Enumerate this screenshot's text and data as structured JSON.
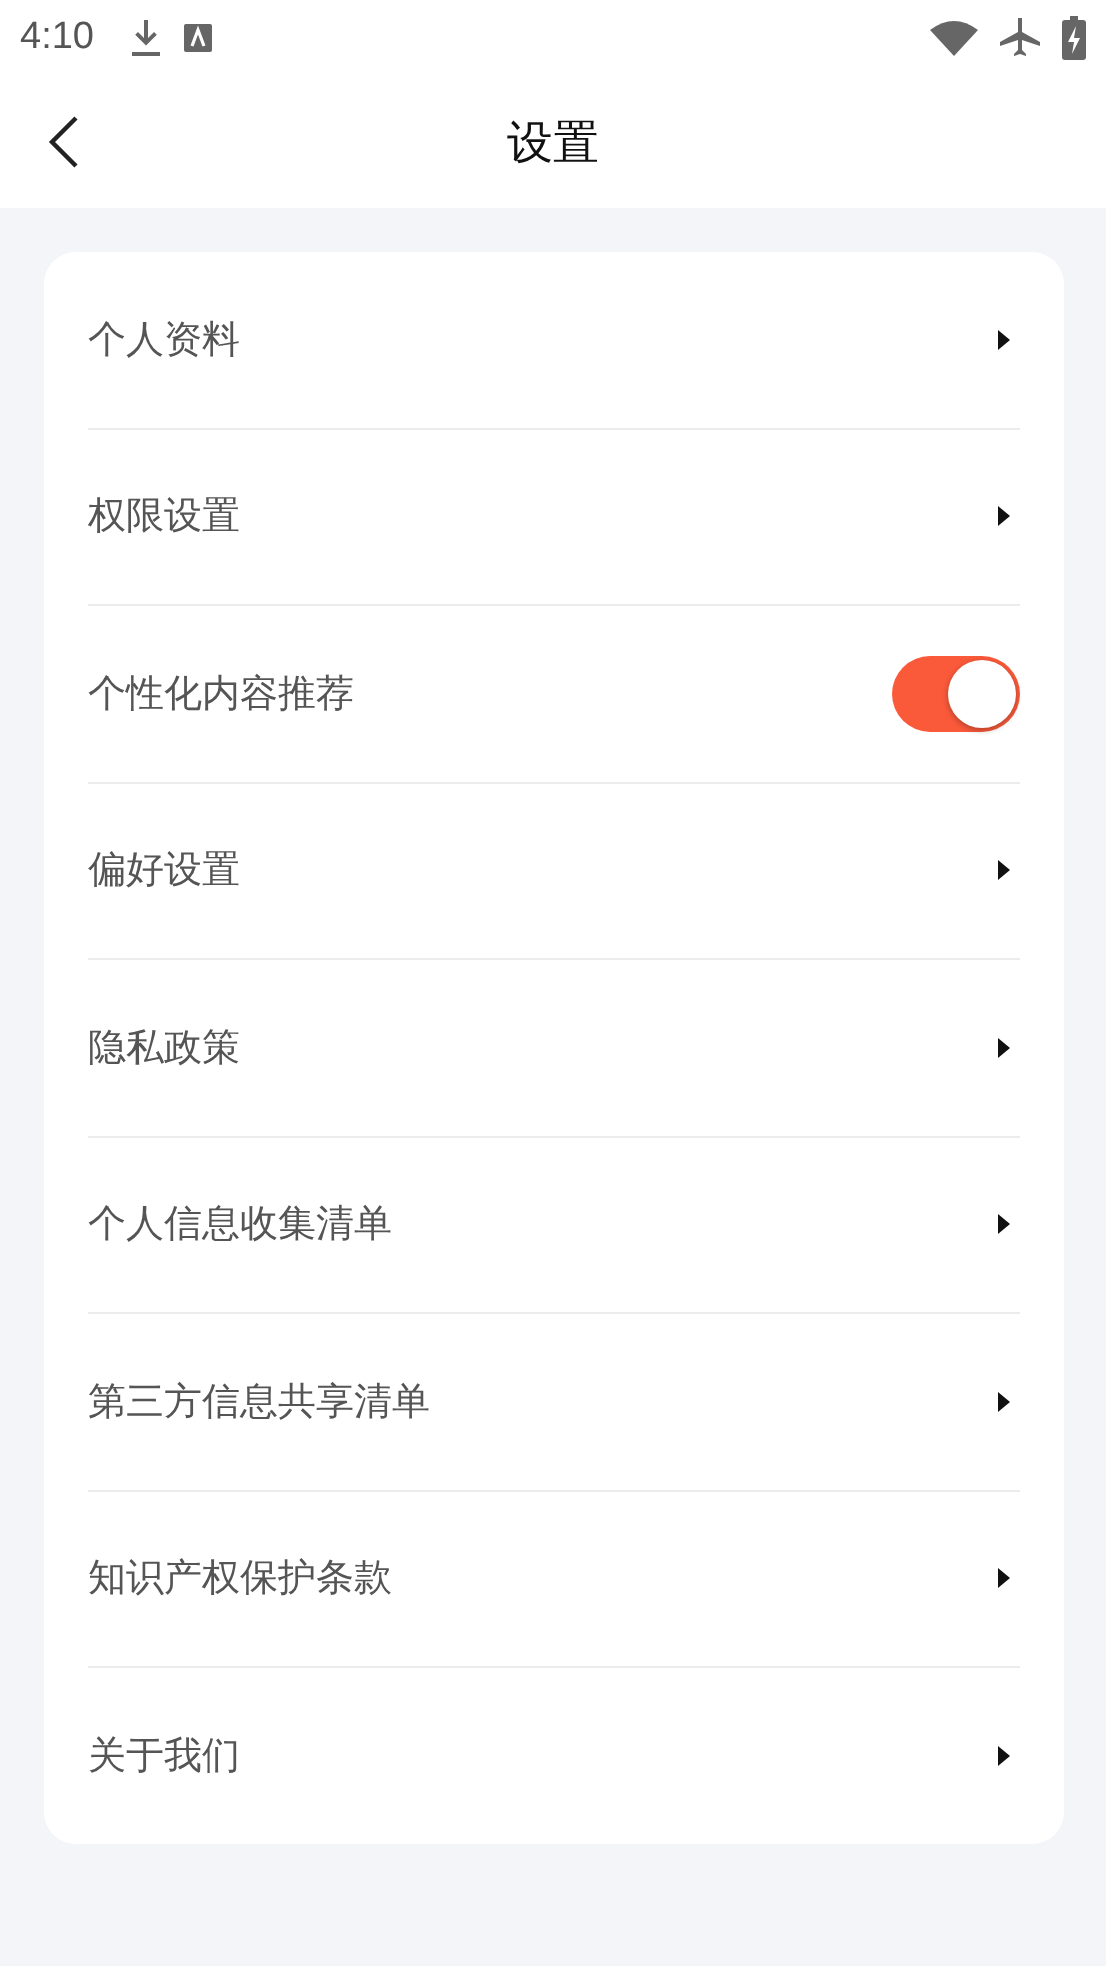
{
  "status_bar": {
    "time": "4:10"
  },
  "header": {
    "title": "设置"
  },
  "items": [
    {
      "label": "个人资料",
      "kind": "link"
    },
    {
      "label": "权限设置",
      "kind": "link"
    },
    {
      "label": "个性化内容推荐",
      "kind": "toggle",
      "on": true
    },
    {
      "label": "偏好设置",
      "kind": "link"
    },
    {
      "label": "隐私政策",
      "kind": "link"
    },
    {
      "label": "个人信息收集清单",
      "kind": "link"
    },
    {
      "label": "第三方信息共享清单",
      "kind": "link"
    },
    {
      "label": "知识产权保护条款",
      "kind": "link"
    },
    {
      "label": "关于我们",
      "kind": "link"
    }
  ]
}
